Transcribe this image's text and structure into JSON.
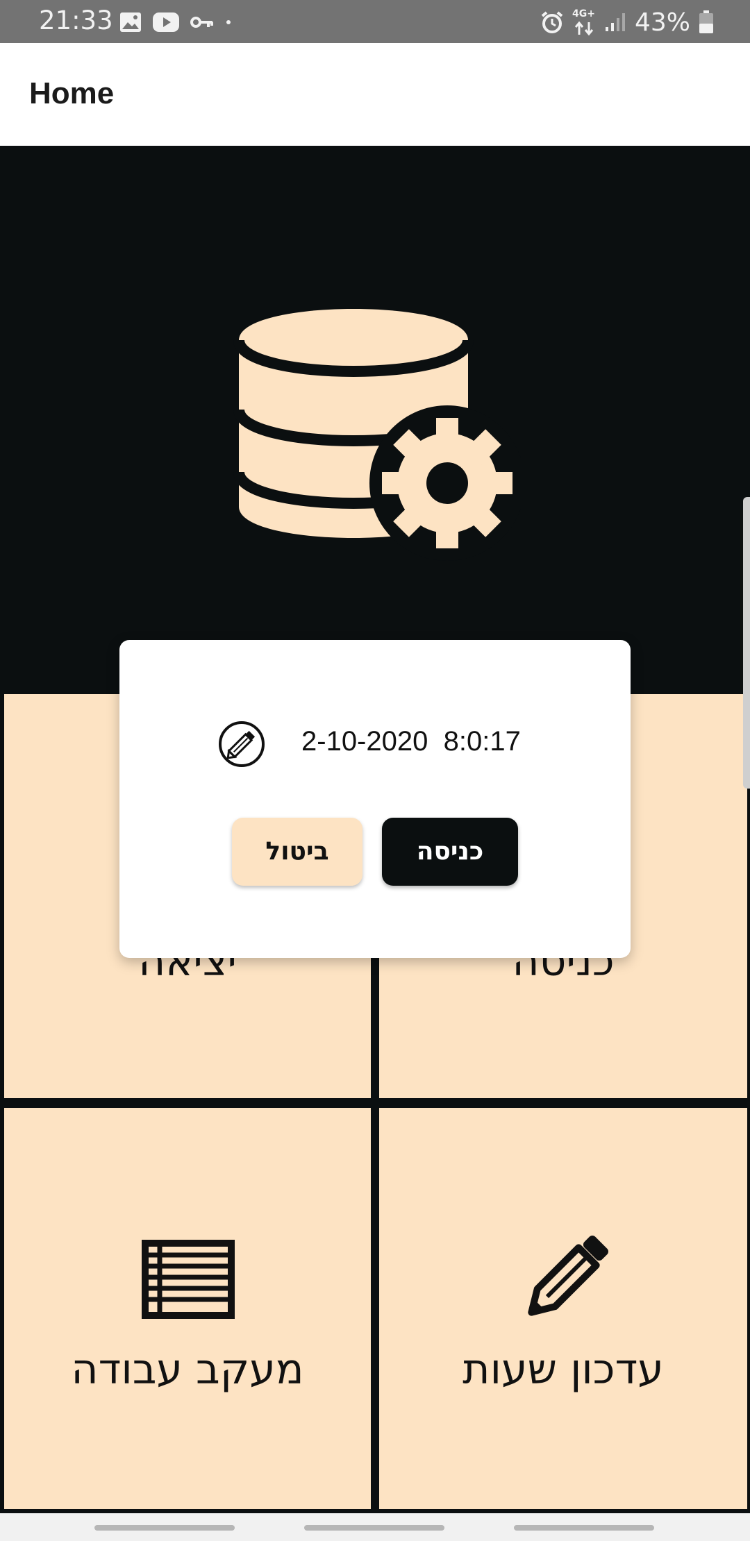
{
  "status_bar": {
    "time": "21:33",
    "icons": [
      "image-icon",
      "youtube-icon",
      "key-icon",
      "dot-icon"
    ],
    "right_icons": [
      "alarm-icon",
      "data-4g-icon",
      "signal-icon",
      "battery-icon"
    ],
    "network": "4G+",
    "battery": "43%"
  },
  "app_bar": {
    "title": "Home"
  },
  "hero": {
    "icon": "database-gear-icon"
  },
  "tiles": [
    {
      "label": "כניסה",
      "icon": "enter-icon"
    },
    {
      "label": "יציאה",
      "icon": "exit-icon"
    },
    {
      "label": "עדכון שעות",
      "icon": "pencil-icon"
    },
    {
      "label": "מעקב עבודה",
      "icon": "list-icon"
    }
  ],
  "dialog": {
    "date": "2-10-2020",
    "time": "8:0:17",
    "icon": "edit-pencil-icon",
    "confirm_label": "כניסה",
    "cancel_label": "ביטול"
  },
  "colors": {
    "primary_dark": "#0b0f10",
    "accent_peach": "#fde3c3",
    "status_bar": "#737373"
  }
}
